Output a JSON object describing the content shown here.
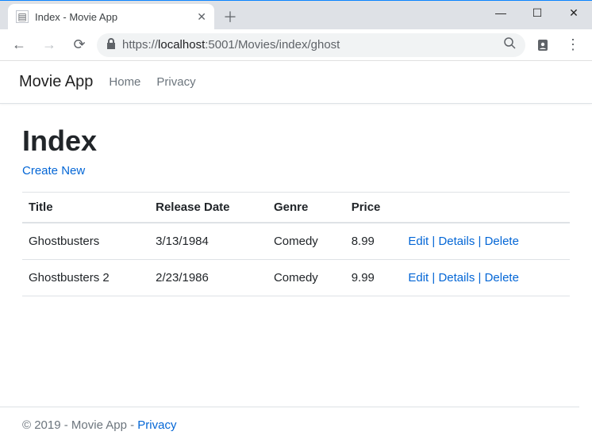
{
  "browser": {
    "tab_title": "Index - Movie App",
    "url_scheme": "https://",
    "url_host": "localhost",
    "url_port_path": ":5001/Movies/index/ghost"
  },
  "nav": {
    "brand": "Movie App",
    "links": {
      "home": "Home",
      "privacy": "Privacy"
    }
  },
  "page": {
    "heading": "Index",
    "create_label": "Create New",
    "columns": {
      "title": "Title",
      "release": "Release Date",
      "genre": "Genre",
      "price": "Price"
    },
    "actions": {
      "edit": "Edit",
      "details": "Details",
      "delete": "Delete"
    },
    "rows": [
      {
        "title": "Ghostbusters",
        "release": "3/13/1984",
        "genre": "Comedy",
        "price": "8.99"
      },
      {
        "title": "Ghostbusters 2",
        "release": "2/23/1986",
        "genre": "Comedy",
        "price": "9.99"
      }
    ]
  },
  "footer": {
    "text": "© 2019 - Movie App - ",
    "privacy": "Privacy"
  }
}
